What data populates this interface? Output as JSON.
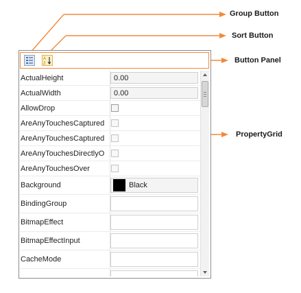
{
  "annotations": {
    "group_button": "Group Button",
    "sort_button": "Sort Button",
    "button_panel": "Button Panel",
    "property_grid": "PropertyGrid",
    "arrow_color": "#f08a3c"
  },
  "toolbar": {
    "group_icon": "group-icon",
    "sort_icon": "sort-icon"
  },
  "properties": [
    {
      "name": "ActualHeight",
      "type": "text",
      "value": "0.00"
    },
    {
      "name": "ActualWidth",
      "type": "text",
      "value": "0.00"
    },
    {
      "name": "AllowDrop",
      "type": "check",
      "checked": false
    },
    {
      "name": "AreAnyTouchesCaptured",
      "type": "check",
      "checked": false,
      "disabled": true
    },
    {
      "name": "AreAnyTouchesCaptured",
      "type": "check",
      "checked": false,
      "disabled": true
    },
    {
      "name": "AreAnyTouchesDirectlyO",
      "type": "check",
      "checked": false,
      "disabled": true
    },
    {
      "name": "AreAnyTouchesOver",
      "type": "check",
      "checked": false,
      "disabled": true
    },
    {
      "name": "Background",
      "type": "color",
      "value": "Black",
      "color": "#000000"
    },
    {
      "name": "BindingGroup",
      "type": "empty"
    },
    {
      "name": "BitmapEffect",
      "type": "empty"
    },
    {
      "name": "BitmapEffectInput",
      "type": "empty"
    },
    {
      "name": "CacheMode",
      "type": "empty"
    },
    {
      "name": "",
      "type": "empty"
    }
  ]
}
